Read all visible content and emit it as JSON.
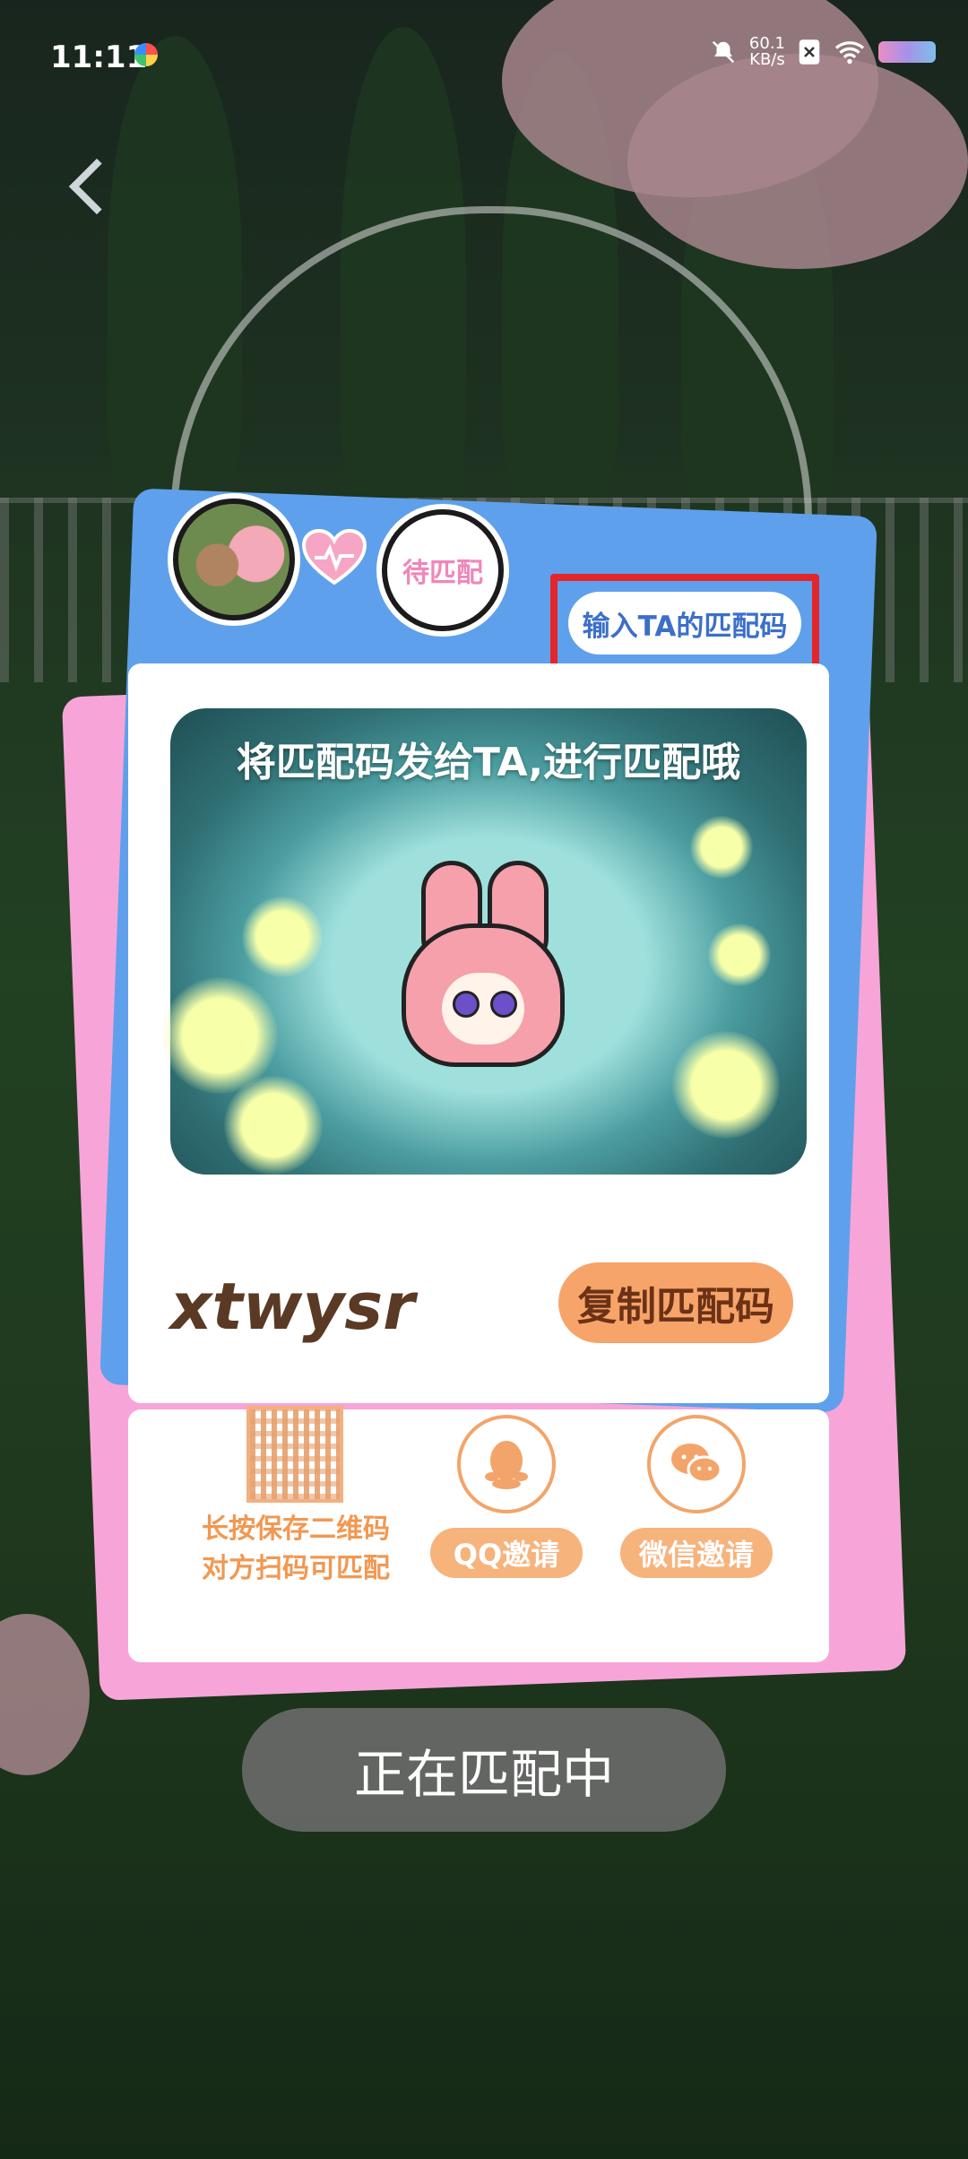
{
  "status_bar": {
    "time": "11:11",
    "net_speed_value": "60.1",
    "net_speed_unit": "KB/s"
  },
  "nav": {
    "back_icon": "chevron-left-icon"
  },
  "avatars": {
    "self_icon": "character-avatar-icon",
    "heart_icon": "heartbeat-icon",
    "pending_label": "待匹配"
  },
  "enter_code_button": {
    "label": "输入TA的匹配码"
  },
  "illustration": {
    "title": "将匹配码发给TA,进行匹配哦"
  },
  "match_code": {
    "code": "xtwysr",
    "copy_button": "复制匹配码"
  },
  "share": {
    "qr_caption_line1": "长按保存二维码",
    "qr_caption_line2": "对方扫码可匹配",
    "qq_label": "QQ邀请",
    "wechat_label": "微信邀请",
    "qq_icon": "qq-penguin-icon",
    "wechat_icon": "wechat-icon"
  },
  "status_button": {
    "label": "正在匹配中"
  },
  "colors": {
    "accent_orange": "#f7a46a",
    "card_blue": "#5fa0ec",
    "card_pink": "#f7a5d8",
    "highlight_red": "#e2262b"
  }
}
